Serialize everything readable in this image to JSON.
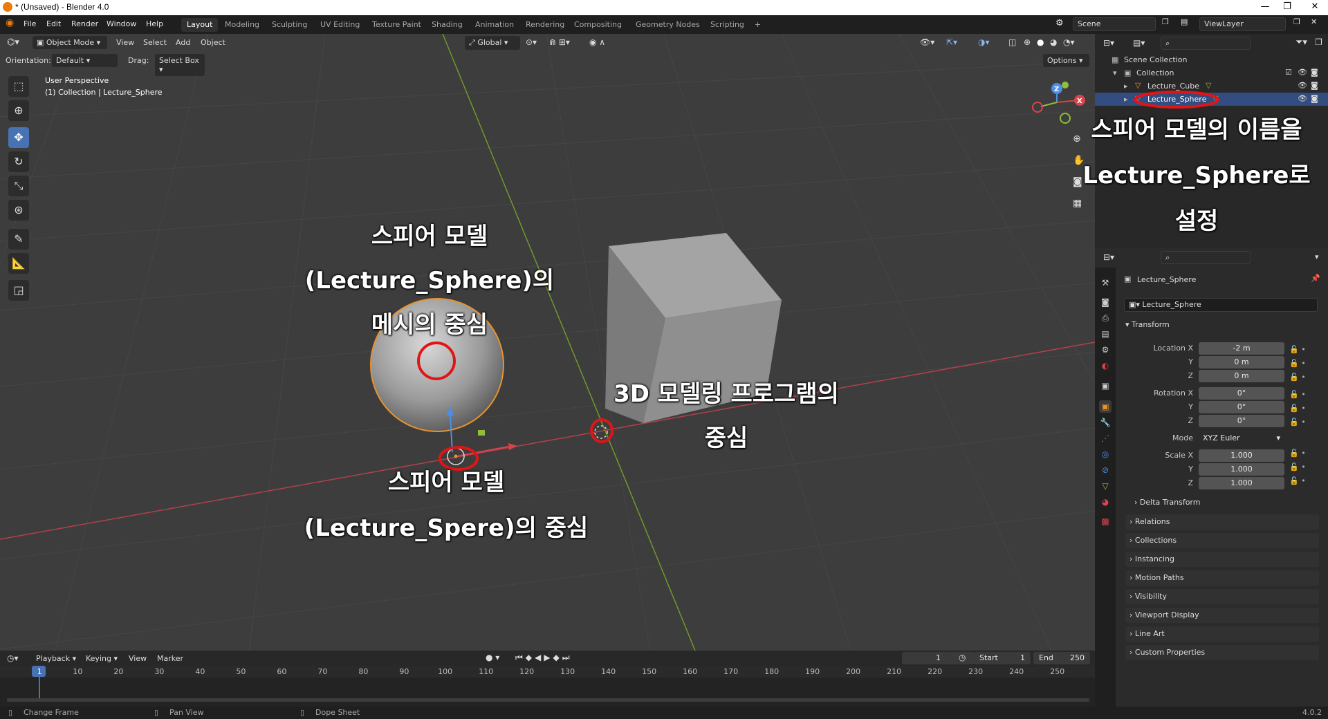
{
  "window": {
    "title": "* (Unsaved) - Blender 4.0",
    "controls": [
      "—",
      "❐",
      "✕"
    ]
  },
  "menu": [
    "File",
    "Edit",
    "Render",
    "Window",
    "Help"
  ],
  "workspaces": [
    "Layout",
    "Modeling",
    "Sculpting",
    "UV Editing",
    "Texture Paint",
    "Shading",
    "Animation",
    "Rendering",
    "Compositing",
    "Geometry Nodes",
    "Scripting",
    "+"
  ],
  "scene": {
    "scene_name": "Scene",
    "view_layer": "ViewLayer"
  },
  "viewport_header": {
    "mode": "Object Mode",
    "menus": [
      "View",
      "Select",
      "Add",
      "Object"
    ],
    "transform_orientation": "Global",
    "options": "Options"
  },
  "tool_settings": {
    "orientation_label": "Orientation:",
    "orientation_value": "Default",
    "drag_label": "Drag:",
    "drag_value": "Select Box"
  },
  "viewport_info": {
    "perspective": "User Perspective",
    "context": "(1) Collection | Lecture_Sphere"
  },
  "gizmo": {
    "z": "Z",
    "x": "X"
  },
  "annotations": {
    "mesh_center_1": "스피어 모델",
    "mesh_center_2": "(Lecture_Sphere)의",
    "mesh_center_3": "메시의 중심",
    "origin_1": "스피어 모델",
    "origin_2": "(Lecture_Spere)의 중심",
    "world_center_1": "3D 모델링 프로그램의",
    "world_center_2": "중심",
    "rename_1": "스피어 모델의 이름을",
    "rename_2": "Lecture_Sphere로",
    "rename_3": "설정"
  },
  "outliner": {
    "scene_collection": "Scene Collection",
    "collection": "Collection",
    "items": [
      "Lecture_Cube",
      "Lecture_Sphere"
    ]
  },
  "properties": {
    "object_name_header": "Lecture_Sphere",
    "object_name_field": "Lecture_Sphere",
    "transform_label": "Transform",
    "location_labels": [
      "Location X",
      "Y",
      "Z"
    ],
    "location_values": [
      "-2 m",
      "0 m",
      "0 m"
    ],
    "rotation_labels": [
      "Rotation X",
      "Y",
      "Z"
    ],
    "rotation_values": [
      "0°",
      "0°",
      "0°"
    ],
    "mode_label": "Mode",
    "mode_value": "XYZ Euler",
    "scale_labels": [
      "Scale X",
      "Y",
      "Z"
    ],
    "scale_values": [
      "1.000",
      "1.000",
      "1.000"
    ],
    "delta": "Delta Transform",
    "panels": [
      "Relations",
      "Collections",
      "Instancing",
      "Motion Paths",
      "Visibility",
      "Viewport Display",
      "Line Art",
      "Custom Properties"
    ]
  },
  "timeline": {
    "menus": [
      "Playback",
      "Keying",
      "View",
      "Marker"
    ],
    "current_frame": "1",
    "start_label": "Start",
    "start_value": "1",
    "end_label": "End",
    "end_value": "250",
    "ticks": [
      "1",
      "10",
      "20",
      "30",
      "40",
      "50",
      "60",
      "70",
      "80",
      "90",
      "100",
      "110",
      "120",
      "130",
      "140",
      "150",
      "160",
      "170",
      "180",
      "190",
      "200",
      "210",
      "220",
      "230",
      "240",
      "250"
    ]
  },
  "status": {
    "change_frame": "Change Frame",
    "pan_view": "Pan View",
    "dope_sheet": "Dope Sheet",
    "version": "4.0.2"
  },
  "colors": {
    "accent": "#4772b3",
    "selection": "#334d80",
    "object_outline": "#e8932e",
    "annotation_red": "#e01515"
  }
}
